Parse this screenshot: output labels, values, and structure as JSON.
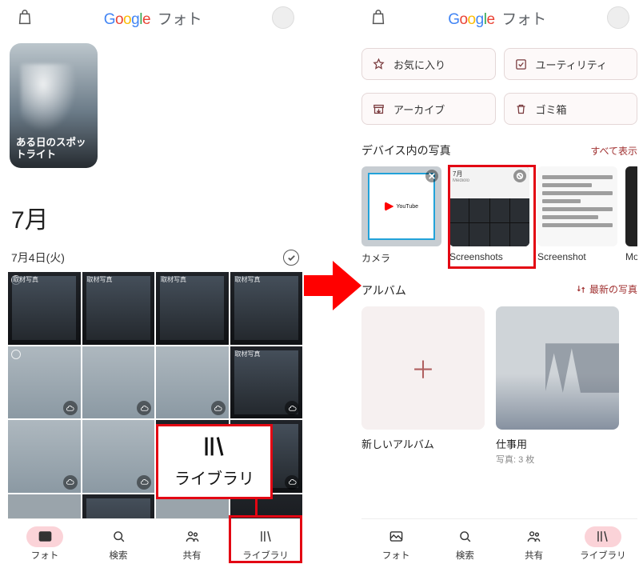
{
  "app": {
    "logo_suffix": "フォト"
  },
  "left": {
    "spotlight_caption": "ある日のスポットライト",
    "month": "7月",
    "date": "7月4日(火)",
    "thumb_tag": "取材写真",
    "nav": {
      "photos": "フォト",
      "search": "検索",
      "sharing": "共有",
      "library": "ライブラリ"
    },
    "callout_label": "ライブラリ"
  },
  "right": {
    "chips": {
      "favorites": "お気に入り",
      "utilities": "ユーティリティ",
      "archive": "アーカイブ",
      "trash": "ゴミ箱"
    },
    "device_section": {
      "title": "デバイス内の写真",
      "all": "すべて表示",
      "items": [
        "カメラ",
        "Screenshots",
        "Screenshot",
        "Mo"
      ]
    },
    "albums_section": {
      "title": "アルバム",
      "sort": "最新の写真",
      "new_album": "新しいアルバム",
      "work": {
        "name": "仕事用",
        "sub": "写真: 3 枚"
      }
    },
    "nav": {
      "photos": "フォト",
      "search": "検索",
      "sharing": "共有",
      "library": "ライブラリ"
    },
    "ss_small": {
      "month": "7月",
      "sub": "Mediolo"
    }
  }
}
